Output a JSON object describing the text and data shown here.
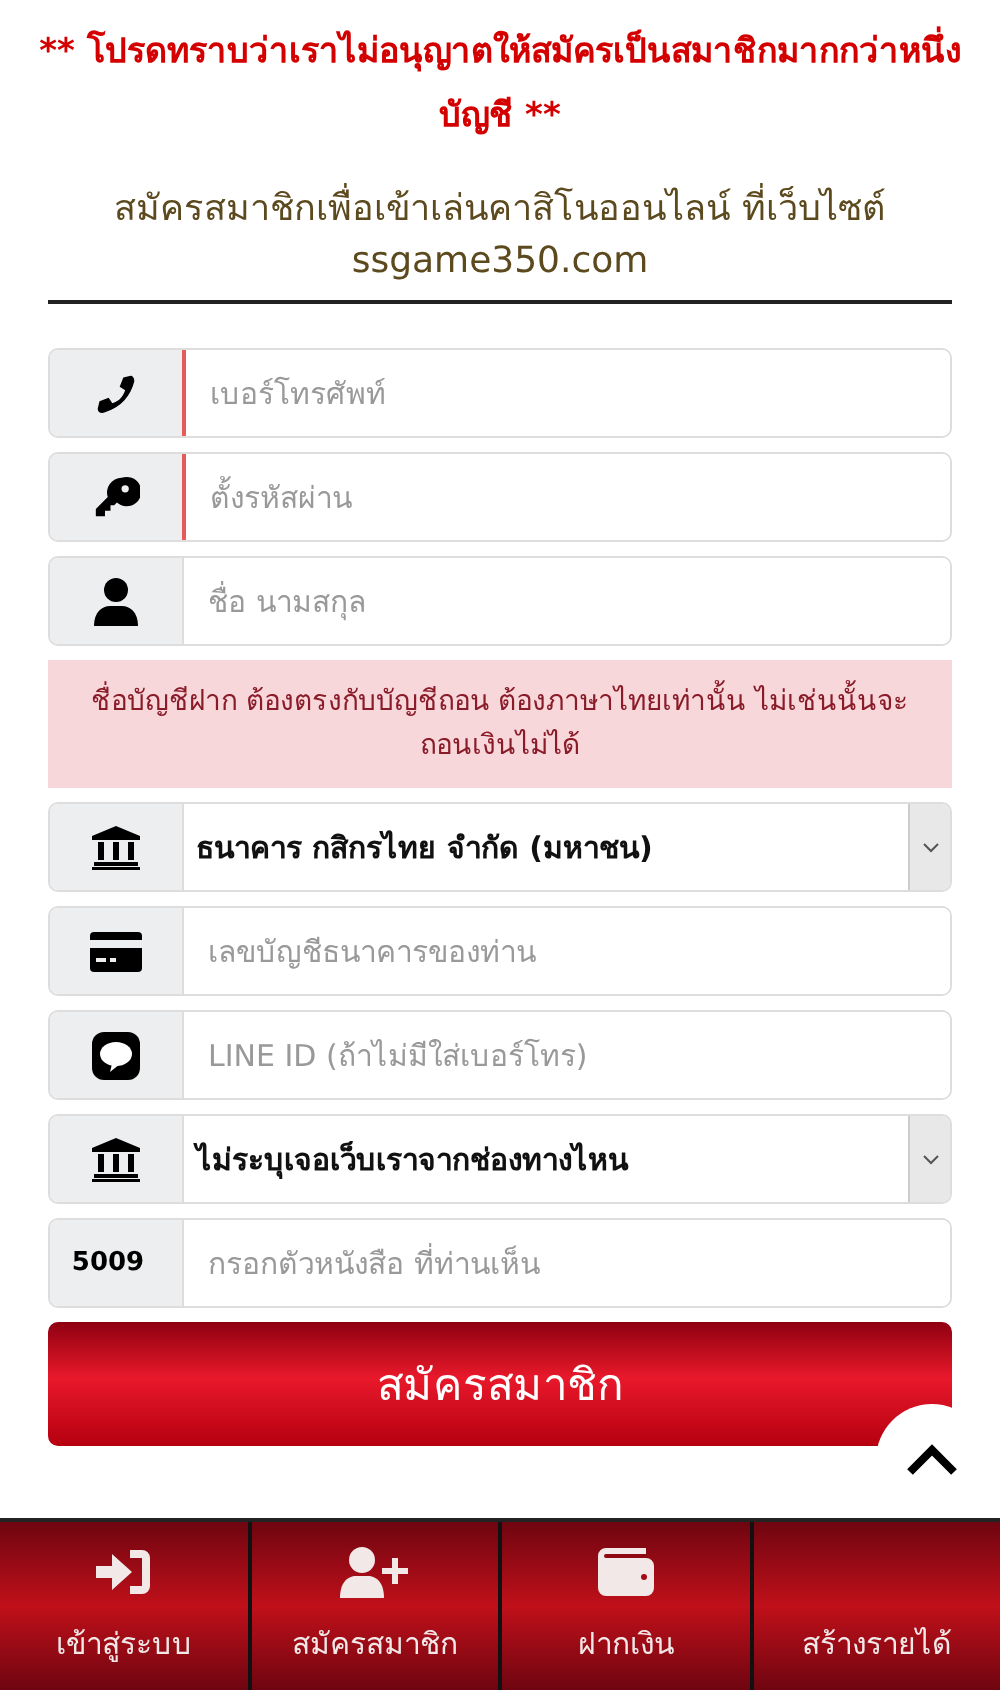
{
  "notice": "** โปรดทราบว่าเราไม่อนุญาตให้สมัครเป็นสมาชิกมากกว่าหนึ่งบัญชี **",
  "heading": {
    "line1": "สมัครสมาชิกเพื่อเข้าเล่นคาสิโนออนไลน์ ที่เว็บไซต์",
    "line2": "ssgame350.com"
  },
  "fields": [
    {
      "placeholder": "เบอร์โทรศัพท์",
      "invalid": true
    },
    {
      "placeholder": "ตั้งรหัสผ่าน",
      "invalid": true
    },
    {
      "placeholder": "ชื่อ นามสกุล",
      "invalid": false
    }
  ],
  "alert": "ชื่อบัญชีฝาก ต้องตรงกับบัญชีถอน ต้องภาษาไทยเท่านั้น ไม่เช่นนั้นจะถอนเงินไม่ได้",
  "fields2": [
    {
      "kind": "select",
      "value": "ธนาคาร กสิกรไทย จำกัด (มหาชน)"
    },
    {
      "kind": "input",
      "placeholder": "เลขบัญชีธนาคารของท่าน"
    },
    {
      "kind": "input",
      "placeholder": "LINE ID (ถ้าไม่มีใส่เบอร์โทร)"
    },
    {
      "kind": "select",
      "value": "ไม่ระบุเจอเว็บเราจากช่องทางไหน"
    },
    {
      "kind": "captcha",
      "code": "5009",
      "placeholder": "กรอกตัวหนังสือ ที่ท่านเห็น"
    }
  ],
  "submit": "สมัครสมาชิก",
  "nav": [
    {
      "label": "เข้าสู่ระบบ"
    },
    {
      "label": "สมัครสมาชิก"
    },
    {
      "label": "ฝากเงิน"
    },
    {
      "label": "สร้างรายได้"
    }
  ]
}
